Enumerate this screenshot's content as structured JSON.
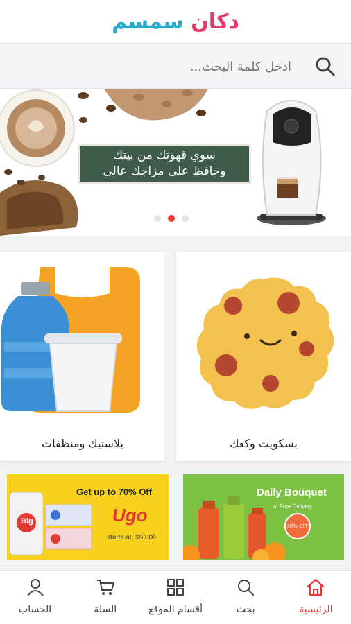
{
  "app": {
    "logo_text": "دكان سمسم"
  },
  "search": {
    "placeholder": "ادخل كلمة البحث..."
  },
  "banner": {
    "line1": "سوي قهوتك من بيتك",
    "line2": "وحافظ على مزاجك عالي",
    "slides": 3,
    "active_slide": 2
  },
  "categories": [
    {
      "label": "بسكويت وكعك",
      "icon": "cookie-icon"
    },
    {
      "label": "بلاستيك ومنظفات",
      "icon": "plastic-bottle-icon"
    }
  ],
  "promos": {
    "bouquet": {
      "title": "Daily Bouquet",
      "subtitle": "at Free Delivery",
      "badge": "30% OFF"
    },
    "ugo": {
      "headline": "Get up to 70% Off",
      "brand": "Ugo",
      "price_note": "starts at, $9.00/-",
      "product": "Big"
    }
  },
  "nav": [
    {
      "label": "الرئيسية",
      "icon": "home-icon",
      "active": true
    },
    {
      "label": "بحث",
      "icon": "search-icon",
      "active": false
    },
    {
      "label": "أقسام الموقع",
      "icon": "grid-icon",
      "active": false
    },
    {
      "label": "السلة",
      "icon": "cart-icon",
      "active": false
    },
    {
      "label": "الحساب",
      "icon": "user-icon",
      "active": false
    }
  ],
  "colors": {
    "accent": "#e53935",
    "logo_pink": "#e5396a",
    "logo_orange": "#f4a42a",
    "logo_blue": "#29a8c9"
  }
}
